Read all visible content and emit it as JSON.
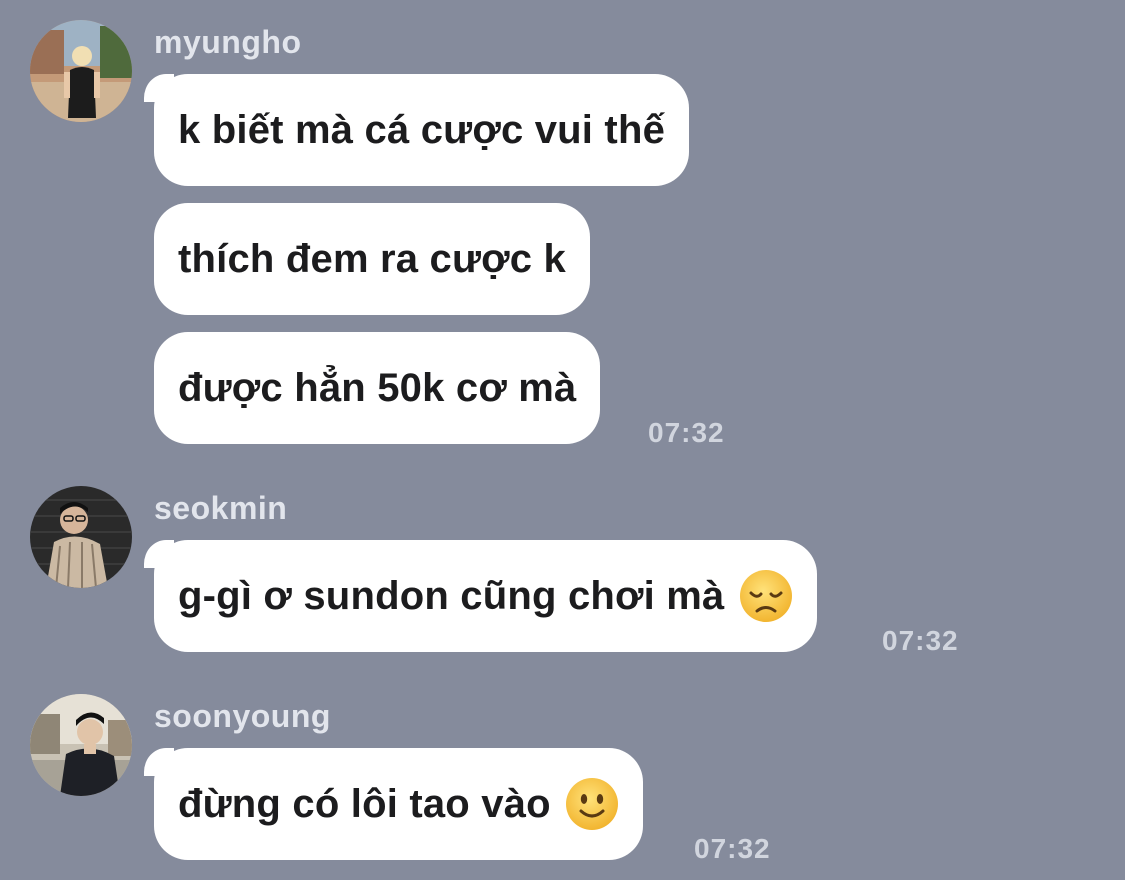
{
  "messages": [
    {
      "sender": "myungho",
      "avatar_icon": "avatar-photo-icon",
      "bubbles": [
        "k biết mà cá cược vui thế",
        "thích đem ra cược k",
        "được hẳn 50k cơ mà"
      ],
      "time": "07:32"
    },
    {
      "sender": "seokmin",
      "avatar_icon": "avatar-photo-icon",
      "bubbles": [
        "g-gì ơ sundon cũng chơi mà"
      ],
      "emoji": "disappointed-face-icon",
      "time": "07:32"
    },
    {
      "sender": "soonyoung",
      "avatar_icon": "avatar-photo-icon",
      "bubbles": [
        "đừng có lôi tao vào"
      ],
      "emoji": "slightly-smiling-face-icon",
      "time": "07:32"
    }
  ],
  "colors": {
    "background": "#858b9c",
    "bubble": "#ffffff",
    "text": "#1c1c1e",
    "sender": "#e2e5ec",
    "time": "#d1d5de",
    "emoji": "#f6c544"
  }
}
